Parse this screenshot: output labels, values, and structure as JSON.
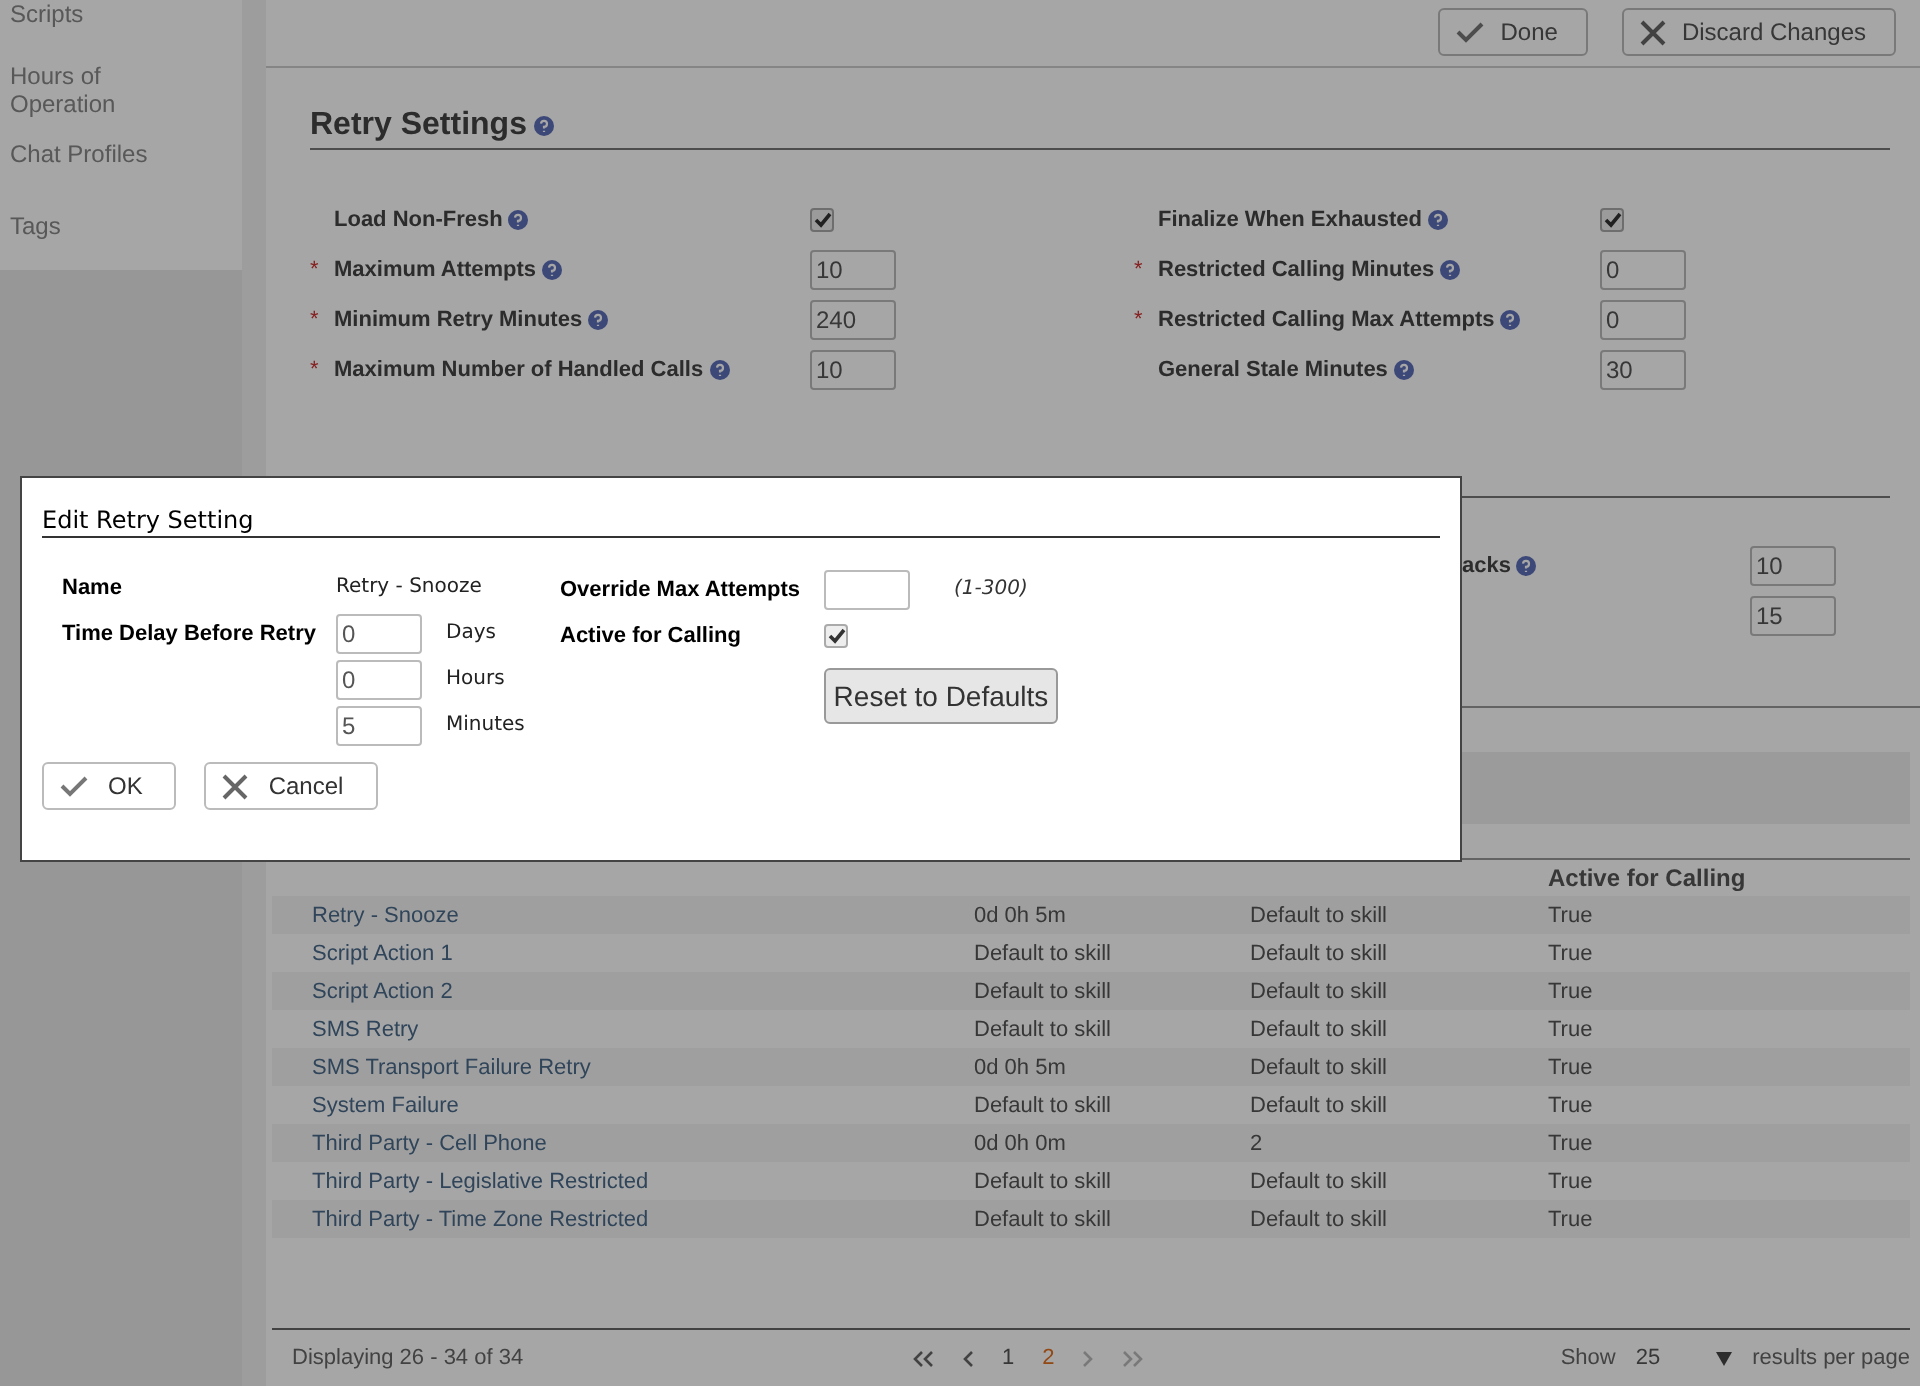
{
  "sidebar": {
    "items": [
      {
        "label": "Scripts"
      },
      {
        "label": "Hours of Operation"
      },
      {
        "label": "Chat Profiles"
      },
      {
        "label": "Tags"
      }
    ]
  },
  "toolbar": {
    "buttons": [
      {
        "label": "Done",
        "kind": "check"
      },
      {
        "label": "Discard Changes",
        "kind": "cross"
      }
    ]
  },
  "retry_settings": {
    "title": "Retry Settings",
    "help": true,
    "left_fields": [
      {
        "label": "Load Non-Fresh",
        "help": true,
        "kind": "checkbox",
        "checked": true
      },
      {
        "label": "Maximum Attempts",
        "help": true,
        "mark": "*",
        "kind": "input",
        "value": "10"
      },
      {
        "label": "Minimum Retry Minutes",
        "help": true,
        "mark": "*",
        "kind": "input",
        "value": "240"
      },
      {
        "label": "Maximum Number of Handled Calls",
        "help": true,
        "mark": "*",
        "kind": "input",
        "value": "10"
      }
    ],
    "right_fields": [
      {
        "label": "Finalize When Exhausted",
        "help": true,
        "kind": "checkbox",
        "checked": true
      },
      {
        "label": "Restricted Calling Minutes",
        "help": true,
        "mark": "*",
        "kind": "input",
        "value": "0"
      },
      {
        "label": "Restricted Calling Max Attempts",
        "help": true,
        "mark": "*",
        "kind": "input",
        "value": "0"
      },
      {
        "label": "General Stale Minutes",
        "help": true,
        "kind": "input",
        "value": "30"
      }
    ]
  },
  "callback_settings": {
    "fields": [
      {
        "label": "acks",
        "help": true,
        "value": "10"
      },
      {
        "value": "15"
      }
    ]
  },
  "table": {
    "column_4_header": "Active for Calling",
    "rows": [
      {
        "name": "Retry - Snooze",
        "reset_period": "0d 0h 5m",
        "max_attempts": "Default to skill",
        "active": "True"
      },
      {
        "name": "Script Action 1",
        "reset_period": "Default to skill",
        "max_attempts": "Default to skill",
        "active": "True"
      },
      {
        "name": "Script Action 2",
        "reset_period": "Default to skill",
        "max_attempts": "Default to skill",
        "active": "True"
      },
      {
        "name": "SMS Retry",
        "reset_period": "Default to skill",
        "max_attempts": "Default to skill",
        "active": "True"
      },
      {
        "name": "SMS Transport Failure Retry",
        "reset_period": "0d 0h 5m",
        "max_attempts": "Default to skill",
        "active": "True"
      },
      {
        "name": "System Failure",
        "reset_period": "Default to skill",
        "max_attempts": "Default to skill",
        "active": "True"
      },
      {
        "name": "Third Party - Cell Phone",
        "reset_period": "0d 0h 0m",
        "max_attempts": "2",
        "active": "True"
      },
      {
        "name": "Third Party - Legislative Restricted",
        "reset_period": "Default to skill",
        "max_attempts": "Default to skill",
        "active": "True"
      },
      {
        "name": "Third Party - Time Zone Restricted",
        "reset_period": "Default to skill",
        "max_attempts": "Default to skill",
        "active": "True"
      }
    ]
  },
  "pagination": {
    "summary": "Displaying 26 - 34 of 34",
    "pages": [
      {
        "label": "1",
        "selected": false
      },
      {
        "label": "2",
        "selected": true
      }
    ],
    "show_label": "Show",
    "per_page": "25",
    "per_page_suffix": "results per page"
  },
  "dialog": {
    "title": "Edit Retry Setting",
    "name_label": "Name",
    "name_value": "Retry - Snooze",
    "delay_label": "Time Delay Before Retry",
    "delay_fields": [
      {
        "value": "0",
        "unit": "Days"
      },
      {
        "value": "0",
        "unit": "Hours"
      },
      {
        "value": "5",
        "unit": "Minutes"
      }
    ],
    "override_label": "Override Max Attempts",
    "override_hint": "(1-300)",
    "active_label": "Active for Calling",
    "active_checked": true,
    "reset_button": "Reset to Defaults",
    "buttons": [
      {
        "label": "OK",
        "kind": "check"
      },
      {
        "label": "Cancel",
        "kind": "cross"
      }
    ]
  }
}
